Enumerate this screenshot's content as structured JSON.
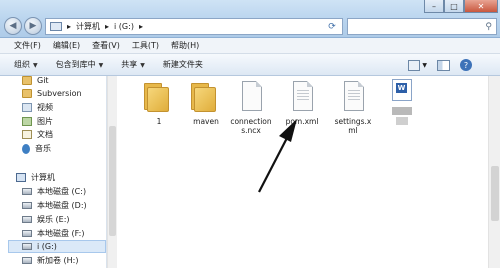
{
  "address": {
    "path": [
      "计算机",
      "i (G:)"
    ]
  },
  "menu": [
    "文件(F)",
    "编辑(E)",
    "查看(V)",
    "工具(T)",
    "帮助(H)"
  ],
  "toolbar": [
    {
      "label": "组织",
      "dropdown": true
    },
    {
      "label": "包含到库中",
      "dropdown": true
    },
    {
      "label": "共享",
      "dropdown": true
    },
    {
      "label": "新建文件夹",
      "dropdown": false
    }
  ],
  "sidebar": {
    "favorites": [
      {
        "label": "Git",
        "icon": "folder-icon"
      },
      {
        "label": "Subversion",
        "icon": "folder-icon"
      },
      {
        "label": "视频",
        "icon": "video-library-icon"
      },
      {
        "label": "图片",
        "icon": "picture-library-icon"
      },
      {
        "label": "文档",
        "icon": "document-library-icon"
      },
      {
        "label": "音乐",
        "icon": "music-library-icon"
      }
    ],
    "computer_label": "计算机",
    "drives": [
      {
        "label": "本地磁盘 (C:)",
        "selected": false
      },
      {
        "label": "本地磁盘 (D:)",
        "selected": false
      },
      {
        "label": "娱乐 (E:)",
        "selected": false
      },
      {
        "label": "本地磁盘 (F:)",
        "selected": false
      },
      {
        "label": "i (G:)",
        "selected": true
      },
      {
        "label": "新加卷 (H:)",
        "selected": false
      }
    ]
  },
  "files": [
    {
      "name": "1",
      "type": "folder"
    },
    {
      "name": "maven",
      "type": "folder"
    },
    {
      "name": "connections.ncx",
      "type": "file"
    },
    {
      "name": "pom.xml",
      "type": "file"
    },
    {
      "name": "settings.xml",
      "type": "file"
    },
    {
      "name": "",
      "type": "word"
    }
  ]
}
